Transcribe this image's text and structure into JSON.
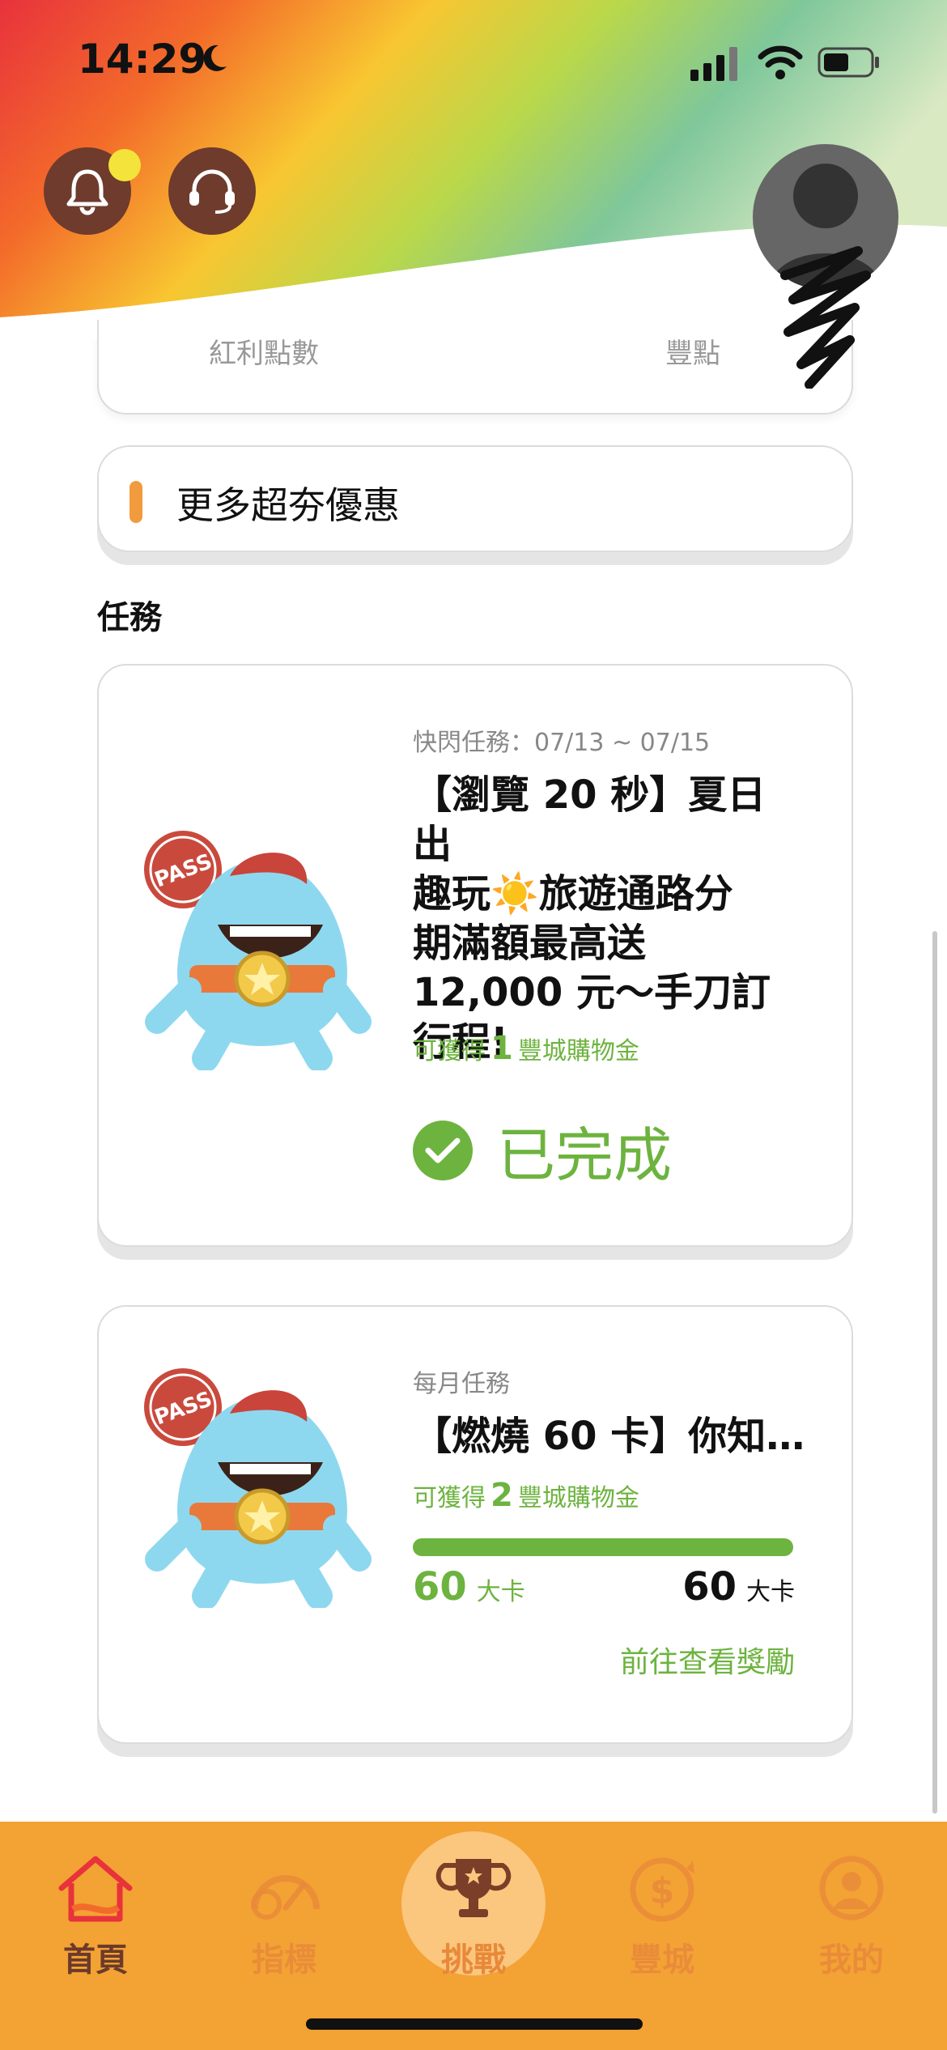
{
  "status_bar": {
    "time": "14:29"
  },
  "header": {
    "icons": [
      "bell-icon",
      "headset-icon",
      "avatar-icon"
    ],
    "notification_dot_color": "#f4e33a"
  },
  "points": {
    "bonus_label": "紅利點數",
    "feng_label": "豐點"
  },
  "promo": {
    "label": "更多超夯優惠"
  },
  "missions": {
    "section_title": "任務",
    "items": [
      {
        "tag": "快閃任務：07/13 ~ 07/15",
        "title_lines": [
          "【瀏覽 20 秒】夏日出",
          "趣玩☀️旅遊通路分",
          "期滿額最高送",
          "12,000 元～手刀訂",
          "行程!"
        ],
        "reward_prefix": "可獲得",
        "reward_amount": "1",
        "reward_suffix": "豐城購物金",
        "status": "已完成"
      },
      {
        "tag": "每月任務",
        "title": "【燃燒 60 卡】你知…",
        "reward_prefix": "可獲得",
        "reward_amount": "2",
        "reward_suffix": "豐城購物金",
        "progress_current": "60",
        "progress_target": "60",
        "progress_unit": "大卡",
        "progress_fraction": 1.0,
        "link": "前往查看獎勵"
      }
    ]
  },
  "tabbar": {
    "tabs": [
      {
        "label": "首頁",
        "icon": "home-icon"
      },
      {
        "label": "指標",
        "icon": "gauge-icon"
      },
      {
        "label": "挑戰",
        "icon": "trophy-icon"
      },
      {
        "label": "豐城",
        "icon": "coin-exchange-icon"
      },
      {
        "label": "我的",
        "icon": "profile-icon"
      }
    ]
  },
  "colors": {
    "accent_green": "#6db33f",
    "tabbar_orange": "#f3a234",
    "promo_bar": "#f29b3e"
  }
}
